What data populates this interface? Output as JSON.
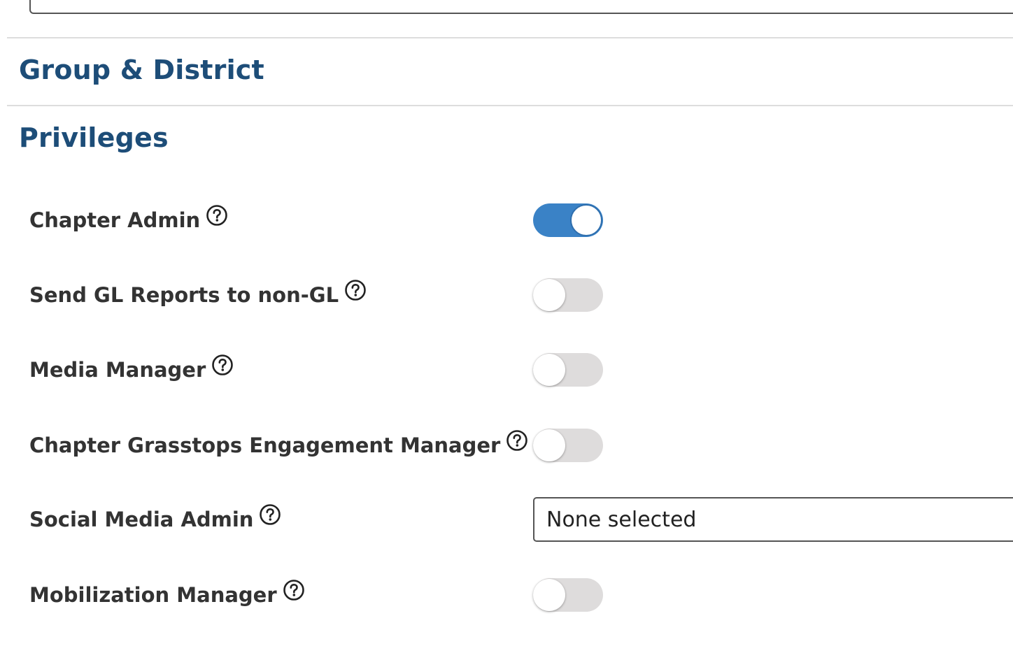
{
  "sections": {
    "group_district": "Group & District",
    "privileges": "Privileges"
  },
  "privileges": [
    {
      "label": "Chapter Admin",
      "type": "toggle",
      "checked": true
    },
    {
      "label": "Send GL Reports to non-GL",
      "type": "toggle",
      "checked": false
    },
    {
      "label": "Media Manager",
      "type": "toggle",
      "checked": false
    },
    {
      "label": "Chapter Grasstops Engagement Manager",
      "type": "toggle",
      "checked": false
    },
    {
      "label": "Social Media Admin",
      "type": "select",
      "value": "None selected"
    },
    {
      "label": "Mobilization Manager",
      "type": "toggle",
      "checked": false
    }
  ],
  "colors": {
    "heading": "#1d4d78",
    "toggle_on": "#3a82c6",
    "toggle_off": "#dedcdc"
  },
  "icons": {
    "help": "question-circle-icon"
  }
}
